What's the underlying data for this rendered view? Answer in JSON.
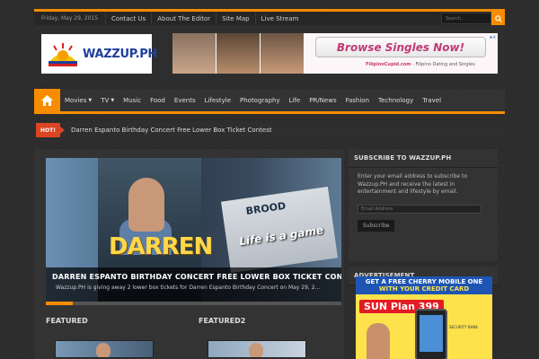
{
  "topbar": {
    "date": "Friday, May 29, 2015",
    "links": [
      "Contact Us",
      "About The Editor",
      "Site Map",
      "Live Stream"
    ],
    "search_placeholder": "Search..."
  },
  "header": {
    "logo_text": "WAZZUP.PH",
    "ad": {
      "cta": "Browse Singles Now!",
      "brand": "FilipinoCupid.com",
      "tagline": " - Filipino Dating and Singles",
      "close": "▸x"
    }
  },
  "nav": {
    "items": [
      {
        "label": "Movies",
        "dropdown": true
      },
      {
        "label": "TV",
        "dropdown": true
      },
      {
        "label": "Music",
        "dropdown": false
      },
      {
        "label": "Food",
        "dropdown": false
      },
      {
        "label": "Events",
        "dropdown": false
      },
      {
        "label": "Lifestyle",
        "dropdown": false
      },
      {
        "label": "Photography",
        "dropdown": false
      },
      {
        "label": "Life",
        "dropdown": false
      },
      {
        "label": "PR/News",
        "dropdown": false
      },
      {
        "label": "Fashion",
        "dropdown": false
      },
      {
        "label": "Technology",
        "dropdown": false
      },
      {
        "label": "Travel",
        "dropdown": false
      }
    ]
  },
  "breaking": {
    "label": "HOT!",
    "headline": "Darren Espanto Birthday Concert Free Lower Box Ticket Contest"
  },
  "slider": {
    "poster_name": "DARREN",
    "poster_brand": "BROOD",
    "poster_slogan": "Life is a game",
    "title": "Darren Espanto Birthday Concert Free Lower Box Ticket Contest",
    "excerpt": "Wazzup.PH is giving away 2 lower box tickets for Darren Espanto Birthday Concert on May 29, 2...",
    "progress": 0.09
  },
  "sections": {
    "featured": "Featured",
    "featured2": "Featured2"
  },
  "sidebar": {
    "subscribe_title": "Subscribe to Wazzup.ph",
    "subscribe_text": "Enter your email address to subscribe to Wazzup.PH and receive the latest in entertainment and lifestyle by email.",
    "email_placeholder": "Email Address",
    "subscribe_button": "Subscribe",
    "ad_title": "Advertisement",
    "ad": {
      "line1": "GET A FREE CHERRY MOBILE ONE",
      "line2": "WITH YOUR CREDIT CARD",
      "plan": "SUN Plan 399",
      "bank": "SECURITY BANK"
    }
  },
  "colors": {
    "accent": "#f88c00",
    "background": "#2b2b2b",
    "hot": "#dd4422"
  }
}
